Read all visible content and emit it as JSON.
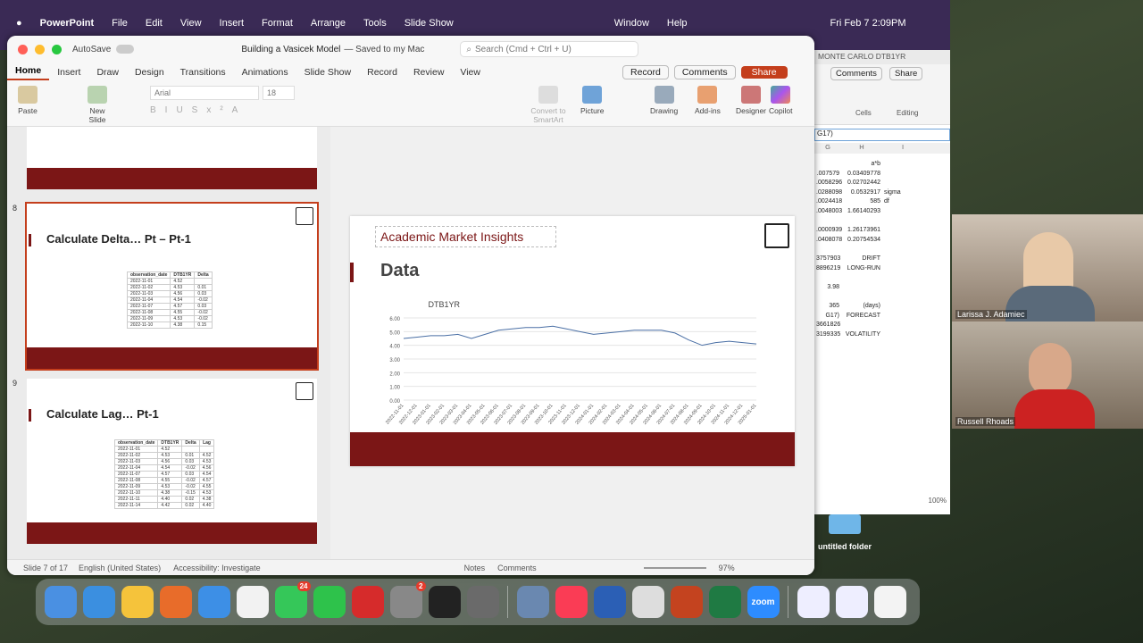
{
  "menubar": {
    "app": "PowerPoint",
    "items": [
      "File",
      "Edit",
      "View",
      "Insert",
      "Format",
      "Arrange",
      "Tools",
      "Slide Show",
      "Window",
      "Help"
    ],
    "clock": "Fri Feb 7  2:09PM"
  },
  "titlebar": {
    "autosave": "AutoSave",
    "title": "Building a Vasicek Model",
    "saved": "— Saved to my Mac",
    "search_placeholder": "Search (Cmd + Ctrl + U)"
  },
  "tabs": [
    "Home",
    "Insert",
    "Draw",
    "Design",
    "Transitions",
    "Animations",
    "Slide Show",
    "Record",
    "Review",
    "View"
  ],
  "tab_actions": {
    "record": "Record",
    "comments": "Comments",
    "share": "Share"
  },
  "ribbon": {
    "paste": "Paste",
    "new_slide": "New\nSlide",
    "font": "Arial",
    "size": "18",
    "convert": "Convert to\nSmartArt",
    "picture": "Picture",
    "drawing": "Drawing",
    "addins": "Add-ins",
    "designer": "Designer",
    "copilot": "Copilot"
  },
  "thumbs": [
    {
      "num": "8",
      "title": "Calculate Delta… Pt – Pt-1",
      "headers": [
        "observation_date",
        "DTB1YR",
        "Delta"
      ],
      "rows": [
        [
          "2022-11-01",
          "4.52",
          ""
        ],
        [
          "2022-11-02",
          "4.53",
          "0.01"
        ],
        [
          "2022-11-03",
          "4.56",
          "0.03"
        ],
        [
          "2022-11-04",
          "4.54",
          "-0.02"
        ],
        [
          "2022-11-07",
          "4.57",
          "0.03"
        ],
        [
          "2022-11-08",
          "4.55",
          "-0.02"
        ],
        [
          "2022-11-09",
          "4.53",
          "-0.02"
        ],
        [
          "2022-11-10",
          "4.38",
          "0.15"
        ]
      ]
    },
    {
      "num": "9",
      "title": "Calculate Lag… Pt-1",
      "headers": [
        "observation_date",
        "DTB1YR",
        "Delta",
        "Lag"
      ],
      "rows": [
        [
          "2022-11-01",
          "4.52",
          "",
          ""
        ],
        [
          "2022-11-02",
          "4.53",
          "0.01",
          "4.52"
        ],
        [
          "2022-11-03",
          "4.56",
          "0.03",
          "4.53"
        ],
        [
          "2022-11-04",
          "4.54",
          "-0.02",
          "4.56"
        ],
        [
          "2022-11-07",
          "4.57",
          "0.03",
          "4.54"
        ],
        [
          "2022-11-08",
          "4.55",
          "-0.02",
          "4.57"
        ],
        [
          "2022-11-09",
          "4.53",
          "-0.02",
          "4.55"
        ],
        [
          "2022-11-10",
          "4.38",
          "-0.15",
          "4.53"
        ],
        [
          "2022-11-11",
          "4.40",
          "0.02",
          "4.38"
        ],
        [
          "2022-11-14",
          "4.42",
          "0.02",
          "4.40"
        ]
      ]
    }
  ],
  "slide": {
    "subtitle": "Academic Market Insights",
    "heading": "Data"
  },
  "chart_data": {
    "type": "line",
    "title": "DTB1YR",
    "ylim": [
      0,
      6
    ],
    "yticks": [
      "0.00",
      "1.00",
      "2.00",
      "3.00",
      "4.00",
      "5.00",
      "6.00"
    ],
    "x": [
      "2022-11-01",
      "2022-12-01",
      "2023-01-01",
      "2023-02-01",
      "2023-03-01",
      "2023-04-01",
      "2023-05-01",
      "2023-06-01",
      "2023-07-01",
      "2023-08-01",
      "2023-09-01",
      "2023-10-01",
      "2023-11-01",
      "2023-12-01",
      "2024-01-01",
      "2024-02-01",
      "2024-03-01",
      "2024-04-01",
      "2024-05-01",
      "2024-06-01",
      "2024-07-01",
      "2024-08-01",
      "2024-09-01",
      "2024-10-01",
      "2024-11-01",
      "2024-12-01",
      "2025-01-01"
    ],
    "series": [
      {
        "values": [
          4.5,
          4.6,
          4.7,
          4.7,
          4.8,
          4.5,
          4.8,
          5.1,
          5.2,
          5.3,
          5.3,
          5.4,
          5.2,
          5.0,
          4.8,
          4.9,
          5.0,
          5.1,
          5.1,
          5.1,
          4.9,
          4.4,
          4.0,
          4.2,
          4.3,
          4.2,
          4.1
        ]
      }
    ]
  },
  "status": {
    "slide": "Slide 7 of 17",
    "lang": "English (United States)",
    "access": "Accessibility: Investigate",
    "notes": "Notes",
    "comments": "Comments",
    "zoom": "97%"
  },
  "excel": {
    "title": "MONTE CARLO DTB1YR",
    "comments": "Comments",
    "share": "Share",
    "cells": "Cells",
    "editing": "Editing",
    "formula": "G17)",
    "cols": [
      "G",
      "H",
      "I"
    ],
    "rows": [
      [
        "",
        "a*b",
        ""
      ],
      [
        ".007579",
        "0.03409778",
        ""
      ],
      [
        ".0058296",
        "0.02702442",
        ""
      ],
      [
        ".0288098",
        "0.0532917",
        "sigma"
      ],
      [
        ".0024418",
        "585",
        "df"
      ],
      [
        ".0048003",
        "1.66140293",
        ""
      ],
      [
        "",
        "",
        ""
      ],
      [
        ".0000939",
        "1.26173961",
        ""
      ],
      [
        ".0408078",
        "0.20754534",
        ""
      ],
      [
        "",
        "",
        ""
      ],
      [
        "3757903",
        "DRIFT",
        ""
      ],
      [
        "8896219",
        "LONG-RUN",
        ""
      ],
      [
        "",
        "",
        ""
      ],
      [
        "3.98",
        "",
        ""
      ],
      [
        "",
        "",
        ""
      ],
      [
        "365",
        "(days)",
        ""
      ],
      [
        "G17)",
        "FORECAST",
        ""
      ],
      [
        "3661826",
        "",
        ""
      ],
      [
        "3199335",
        "VOLATILITY",
        ""
      ]
    ],
    "zoom": "100%"
  },
  "folder": "untitled folder",
  "participants": [
    "Larissa J. Adamiec",
    "Russell Rhoads"
  ],
  "dock": {
    "messages_badge": "24",
    "settings_badge": "2",
    "zoom": "zoom"
  }
}
